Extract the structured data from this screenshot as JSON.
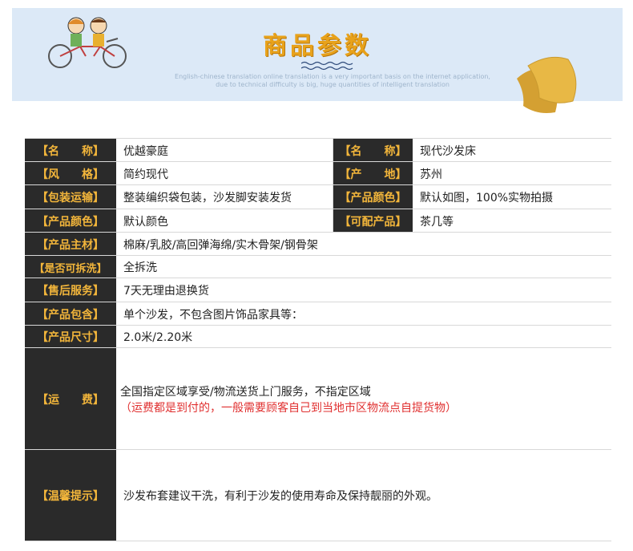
{
  "banner": {
    "title": "商品参数",
    "subtitle_line1": "English-chinese translation online translation is a very important basis on the internet application,",
    "subtitle_line2": "due to technical difficulty is big, huge quantities of intelligent translation"
  },
  "params": [
    {
      "label": "【名　　称】",
      "value": "优越豪庭",
      "label2": "【名　　称】",
      "value2": "现代沙发床"
    },
    {
      "label": "【风　　格】",
      "value": "简约现代",
      "label2": "【产　　地】",
      "value2": "苏州"
    },
    {
      "label": "【包装运输】",
      "value": "整装编织袋包装，沙发脚安装发货",
      "label2": "【产品颜色】",
      "value2": "默认如图，100%实物拍摄"
    },
    {
      "label": "【产品颜色】",
      "value": "默认颜色",
      "label2": "【可配产品】",
      "value2": "茶几等"
    },
    {
      "label": "【产品主材】",
      "value": "棉麻/乳胶/高回弹海绵/实木骨架/钢骨架"
    },
    {
      "label": "【是否可拆洗】",
      "value": "全拆洗"
    },
    {
      "label": "【售后服务】",
      "value": "7天无理由退换货"
    },
    {
      "label": "【产品包含】",
      "value": "单个沙发，不包含图片饰品家具等："
    },
    {
      "label": "【产品尺寸】",
      "value": "2.0米/2.20米"
    },
    {
      "label": "【运　　费】",
      "value": "全国指定区域享受/物流送货上门服务，不指定区域",
      "note": "（运费都是到付的，一般需要顾客自己到当地市区物流点自提货物）"
    },
    {
      "label": "【温馨提示】",
      "value": "沙发布套建议干洗，有利于沙发的使用寿命及保持靓丽的外观。"
    }
  ],
  "colors": {
    "label_bg": "#2a2a2a",
    "label_text": "#f3b63b",
    "title": "#e8a21b",
    "note": "#e03030",
    "banner_bg": "#dce9f7"
  },
  "icons": [
    "tandem-bicycle-illustration",
    "yellow-pillows-illustration",
    "wave-lines-icon"
  ]
}
